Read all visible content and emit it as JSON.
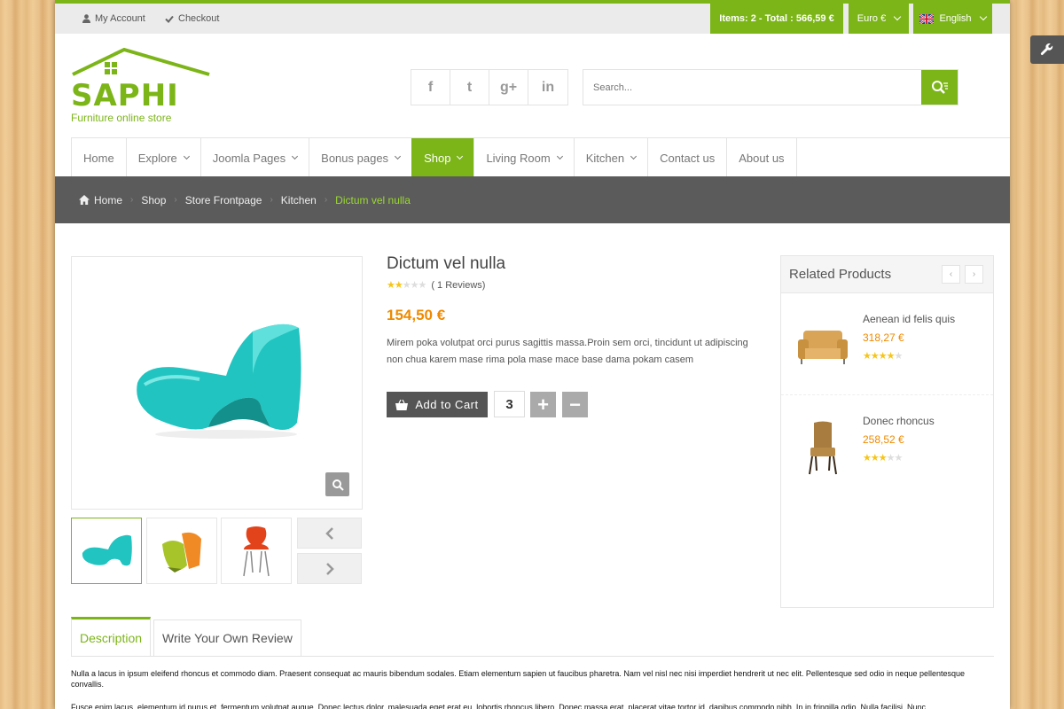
{
  "topbar": {
    "my_account": "My Account",
    "checkout": "Checkout",
    "cart_summary": "Items: 2 - Total : 566,59 €",
    "currency": "Euro €",
    "language": "English"
  },
  "header": {
    "logo_text": "SAPHI",
    "logo_tagline": "Furniture online store",
    "social": [
      {
        "icon": "facebook-icon",
        "glyph": "f"
      },
      {
        "icon": "twitter-icon",
        "glyph": "t"
      },
      {
        "icon": "google-plus-icon",
        "glyph": "g+"
      },
      {
        "icon": "linkedin-icon",
        "glyph": "in"
      }
    ],
    "search_placeholder": "Search..."
  },
  "nav": {
    "items": [
      {
        "label": "Home",
        "dropdown": false,
        "active": false
      },
      {
        "label": "Explore",
        "dropdown": true,
        "active": false
      },
      {
        "label": "Joomla Pages",
        "dropdown": true,
        "active": false
      },
      {
        "label": "Bonus pages",
        "dropdown": true,
        "active": false
      },
      {
        "label": "Shop",
        "dropdown": true,
        "active": true
      },
      {
        "label": "Living Room",
        "dropdown": true,
        "active": false
      },
      {
        "label": "Kitchen",
        "dropdown": true,
        "active": false
      },
      {
        "label": "Contact us",
        "dropdown": false,
        "active": false
      },
      {
        "label": "About us",
        "dropdown": false,
        "active": false
      }
    ]
  },
  "breadcrumb": [
    "Home",
    "Shop",
    "Store Frontpage",
    "Kitchen",
    "Dictum vel nulla"
  ],
  "product": {
    "title": "Dictum vel nulla",
    "rating": 2,
    "reviews": "( 1 Reviews)",
    "price": "154,50 €",
    "description": "Mirem poka volutpat orci purus sagittis massa.Proin sem orci, tincidunt ut adipiscing non chua karem mase rima pola mase mace base dama pokam casem",
    "add_to_cart": "Add to Cart",
    "quantity": "3",
    "plus": "+",
    "minus": "−"
  },
  "related": {
    "title": "Related Products",
    "prev": "‹",
    "next": "›",
    "items": [
      {
        "name": "Aenean id felis quis",
        "price": "318,27 €",
        "rating": 4
      },
      {
        "name": "Donec rhoncus",
        "price": "258,52 €",
        "rating": 3
      }
    ]
  },
  "tabs": {
    "description": "Description",
    "review": "Write Your Own Review"
  },
  "body": {
    "p1": "Nulla a lacus in ipsum eleifend rhoncus et commodo diam. Praesent consequat ac mauris bibendum sodales. Etiam elementum sapien ut faucibus pharetra. Nam vel nisl nec nisi imperdiet hendrerit ut nec elit. Pellentesque sed odio in neque pellentesque convallis.",
    "p2": "Fusce enim lacus, elementum id purus et, fermentum volutpat augue. Donec lectus dolor, malesuada eget erat eu, lobortis rhoncus libero. Donec massa erat, placerat vitae tortor id, dapibus commodo nibh. In in fringilla odio. Nulla facilisi. Nunc"
  },
  "colors": {
    "accent": "#7cb518",
    "price": "#ef8a00",
    "breadcrumb_bg": "#5b5b5b"
  }
}
